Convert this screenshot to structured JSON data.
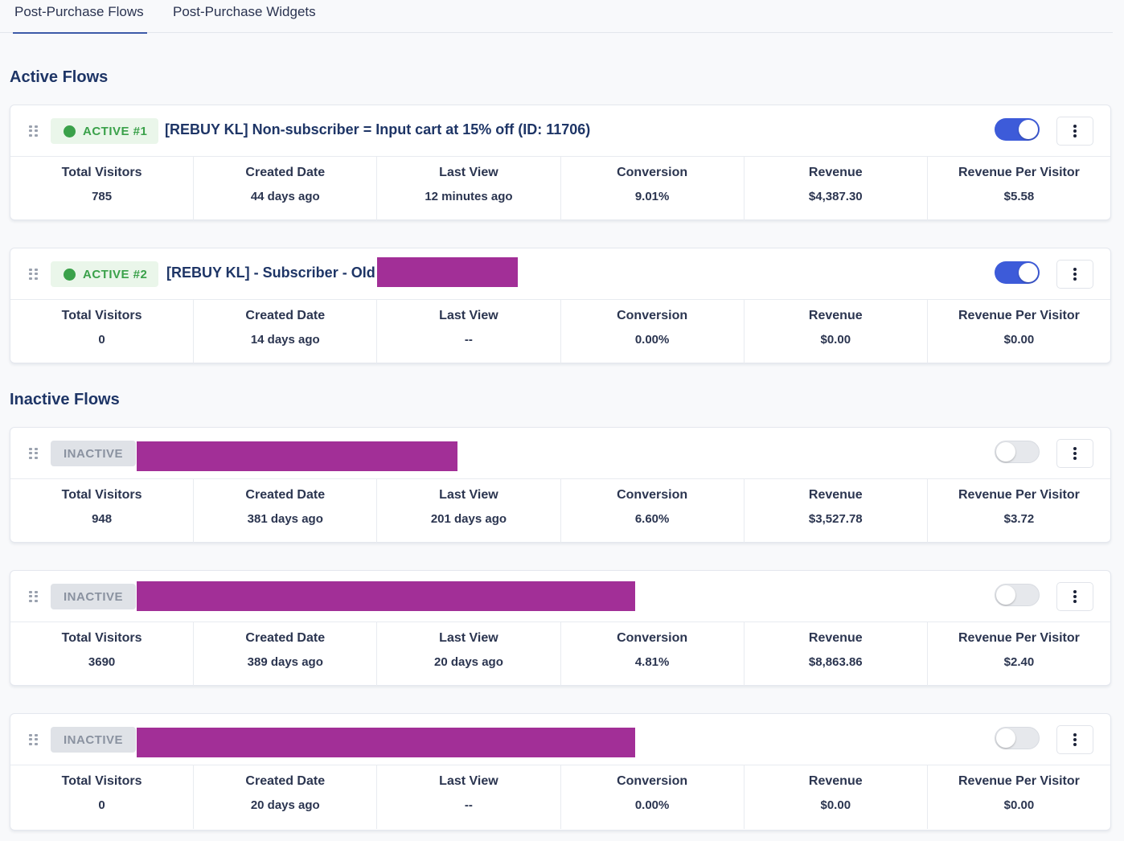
{
  "tabs": [
    {
      "label": "Post-Purchase Flows",
      "selected": true
    },
    {
      "label": "Post-Purchase Widgets",
      "selected": false
    }
  ],
  "sections": {
    "active_title": "Active Flows",
    "inactive_title": "Inactive Flows"
  },
  "stat_labels": [
    "Total Visitors",
    "Created Date",
    "Last View",
    "Conversion",
    "Revenue",
    "Revenue Per Visitor"
  ],
  "flows": [
    {
      "status": "ACTIVE #1",
      "enabled": true,
      "title": "[REBUY KL] Non-subscriber = Input cart at 15% off (ID: 11706)",
      "stats": [
        "785",
        "44 days ago",
        "12 minutes ago",
        "9.01%",
        "$4,387.30",
        "$5.58"
      ]
    },
    {
      "status": "ACTIVE #2",
      "enabled": true,
      "title": "[REBUY KL] - Subscriber - Old",
      "stats": [
        "0",
        "14 days ago",
        "--",
        "0.00%",
        "$0.00",
        "$0.00"
      ]
    },
    {
      "status": "INACTIVE",
      "enabled": false,
      "title": "",
      "stats": [
        "948",
        "381 days ago",
        "201 days ago",
        "6.60%",
        "$3,527.78",
        "$3.72"
      ]
    },
    {
      "status": "INACTIVE",
      "enabled": false,
      "title": "",
      "stats": [
        "3690",
        "389 days ago",
        "20 days ago",
        "4.81%",
        "$8,863.86",
        "$2.40"
      ]
    },
    {
      "status": "INACTIVE",
      "enabled": false,
      "title": "",
      "stats": [
        "0",
        "20 days ago",
        "--",
        "0.00%",
        "$0.00",
        "$0.00"
      ]
    }
  ],
  "colors": {
    "accent": "#3d5bd9",
    "active_green": "#3aa14a",
    "redaction": "#a22f97",
    "heading": "#1e3566"
  },
  "icons": [
    "drag-handle-icon",
    "status-dot-icon",
    "kebab-menu-icon"
  ]
}
